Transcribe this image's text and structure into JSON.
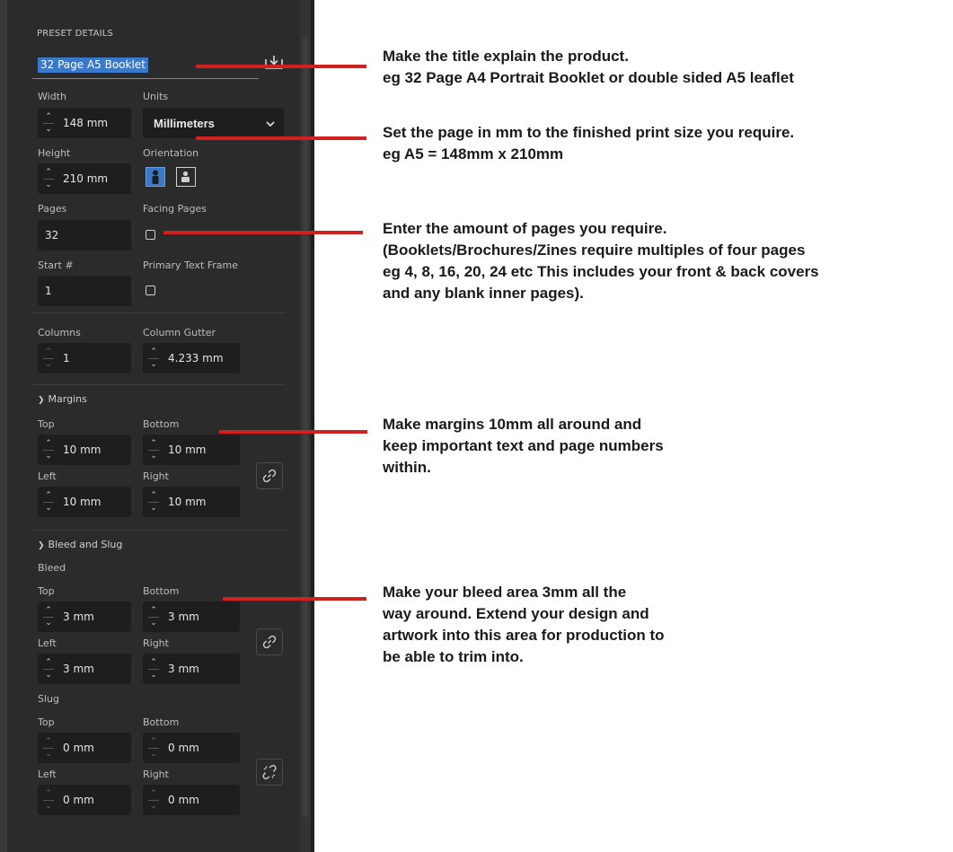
{
  "panel": {
    "header": "PRESET DETAILS",
    "title_value": "32 Page A5 Booklet",
    "save_icon": "save-preset-icon",
    "width_label": "Width",
    "width_value": "148 mm",
    "units_label": "Units",
    "units_value": "Millimeters",
    "height_label": "Height",
    "height_value": "210 mm",
    "orientation_label": "Orientation",
    "orientation_selected": "portrait",
    "pages_label": "Pages",
    "pages_value": "32",
    "facing_pages_label": "Facing Pages",
    "facing_pages_checked": false,
    "start_label": "Start #",
    "start_value": "1",
    "primary_text_frame_label": "Primary Text Frame",
    "primary_text_frame_checked": false,
    "columns_label": "Columns",
    "columns_value": "1",
    "column_gutter_label": "Column Gutter",
    "column_gutter_value": "4.233 mm",
    "margins": {
      "heading": "Margins",
      "top_label": "Top",
      "top_value": "10 mm",
      "bottom_label": "Bottom",
      "bottom_value": "10 mm",
      "left_label": "Left",
      "left_value": "10 mm",
      "right_label": "Right",
      "right_value": "10 mm",
      "linked": true
    },
    "bleed_slug": {
      "heading": "Bleed and Slug",
      "bleed_label": "Bleed",
      "bleed": {
        "top_label": "Top",
        "top_value": "3 mm",
        "bottom_label": "Bottom",
        "bottom_value": "3 mm",
        "left_label": "Left",
        "left_value": "3 mm",
        "right_label": "Right",
        "right_value": "3 mm",
        "linked": true
      },
      "slug_label": "Slug",
      "slug": {
        "top_label": "Top",
        "top_value": "0 mm",
        "bottom_label": "Bottom",
        "bottom_value": "0 mm",
        "left_label": "Left",
        "left_value": "0 mm",
        "right_label": "Right",
        "right_value": "0 mm",
        "linked": false
      }
    }
  },
  "annotations": {
    "title": [
      "Make the title explain the product.",
      "eg 32 Page A4 Portrait Booklet or double sided A5 leaflet"
    ],
    "units": [
      "Set the page in mm to the finished print size you require.",
      "eg A5 = 148mm x 210mm"
    ],
    "pages": [
      "Enter the amount of pages you require.",
      "(Booklets/Brochures/Zines require multiples of four pages",
      " eg 4, 8, 16, 20, 24 etc This includes your front & back covers",
      "and any blank inner pages)."
    ],
    "margins": [
      "Make margins 10mm all around and",
      "keep important text and page numbers",
      "within."
    ],
    "bleed": [
      "Make your bleed area 3mm all the",
      "way around. Extend your design and",
      "artwork into this area for production to",
      "be able to trim into."
    ]
  },
  "colors": {
    "panel_bg": "#2b2b2b",
    "field_bg": "#1e1e1e",
    "accent": "#3a78c9",
    "callout_line": "#d02020"
  }
}
